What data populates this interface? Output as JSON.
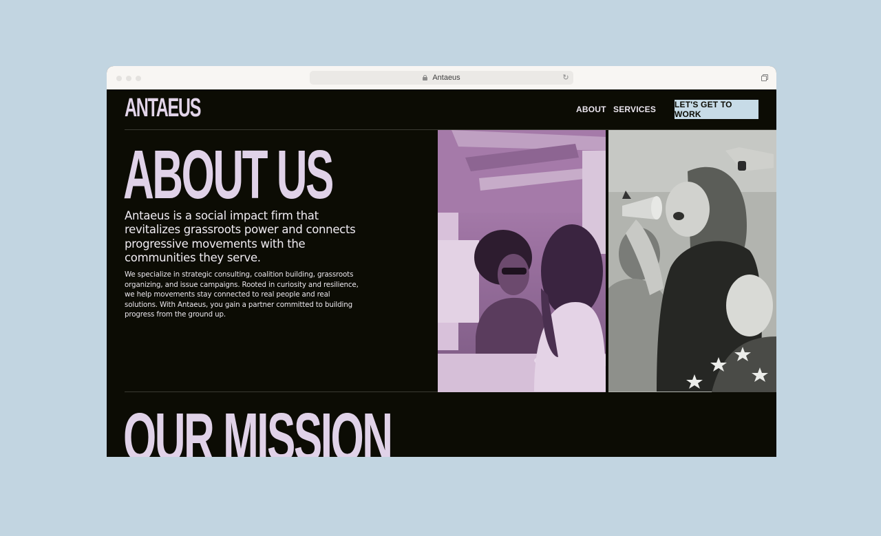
{
  "browser": {
    "tab_title": "Antaeus"
  },
  "header": {
    "logo": "ANTAEUS",
    "nav": [
      {
        "label": "ABOUT"
      },
      {
        "label": "SERVICES"
      }
    ],
    "cta_label": "LET'S GET TO WORK"
  },
  "about": {
    "title": "ABOUT US",
    "lead": "Antaeus is a social impact firm that revitalizes grassroots power and connects progressive movements with the communities they serve.",
    "body": "We specialize in strategic consulting, coalition building, grassroots organizing, and issue campaigns. Rooted in curiosity and resilience, we help movements stay connected to real people and real solutions. With Antaeus, you gain a partner committed to building progress from the ground up."
  },
  "mission": {
    "title": "OUR MISSION"
  },
  "colors": {
    "page_bg": "#c2d5e1",
    "site_bg": "#0c0c04",
    "heading": "#e0d2e8",
    "cta_bg": "#c7dbe7",
    "photo_tint_1": "#b68bb9",
    "photo_tint_2": "#b4b6b1"
  }
}
